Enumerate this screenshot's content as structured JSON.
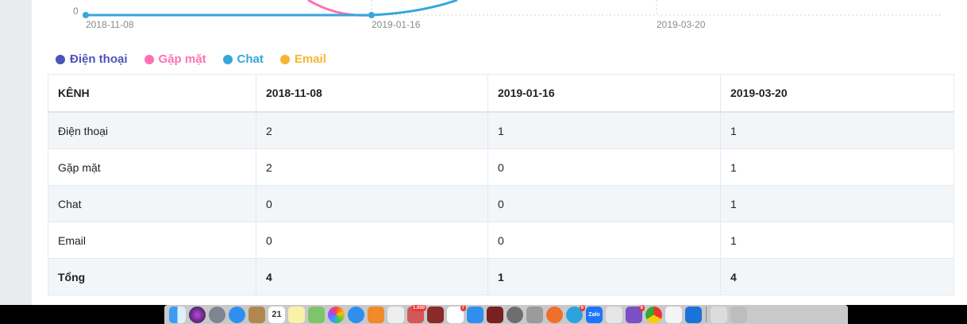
{
  "chart_data": {
    "type": "line",
    "x": [
      "2018-11-08",
      "2019-01-16",
      "2019-03-20"
    ],
    "y_tick_visible": "0",
    "series": [
      {
        "name": "Điện thoại",
        "color": "#4b55b5",
        "values": [
          2,
          1,
          1
        ]
      },
      {
        "name": "Gặp mặt",
        "color": "#ff6fb5",
        "values": [
          2,
          0,
          1
        ]
      },
      {
        "name": "Chat",
        "color": "#35a6dc",
        "values": [
          0,
          0,
          1
        ]
      },
      {
        "name": "Email",
        "color": "#f5b731",
        "values": [
          0,
          0,
          1
        ]
      }
    ]
  },
  "legend": [
    {
      "label": "Điện thoại",
      "color": "#4b55b5"
    },
    {
      "label": "Gặp mặt",
      "color": "#ff6fb5"
    },
    {
      "label": "Chat",
      "color": "#35a6dc"
    },
    {
      "label": "Email",
      "color": "#f5b731"
    }
  ],
  "table": {
    "headers": [
      "KÊNH",
      "2018-11-08",
      "2019-01-16",
      "2019-03-20"
    ],
    "rows": [
      [
        "Điện thoại",
        "2",
        "1",
        "1"
      ],
      [
        "Gặp mặt",
        "2",
        "0",
        "1"
      ],
      [
        "Chat",
        "0",
        "0",
        "1"
      ],
      [
        "Email",
        "0",
        "0",
        "1"
      ],
      [
        "Tổng",
        "4",
        "1",
        "4"
      ]
    ]
  },
  "dock": {
    "calendar_day": "21",
    "badges": {
      "mail": "1.050",
      "reminders": "7",
      "telegram": "9",
      "viber": "6"
    },
    "zalo_label": "Zalo"
  }
}
